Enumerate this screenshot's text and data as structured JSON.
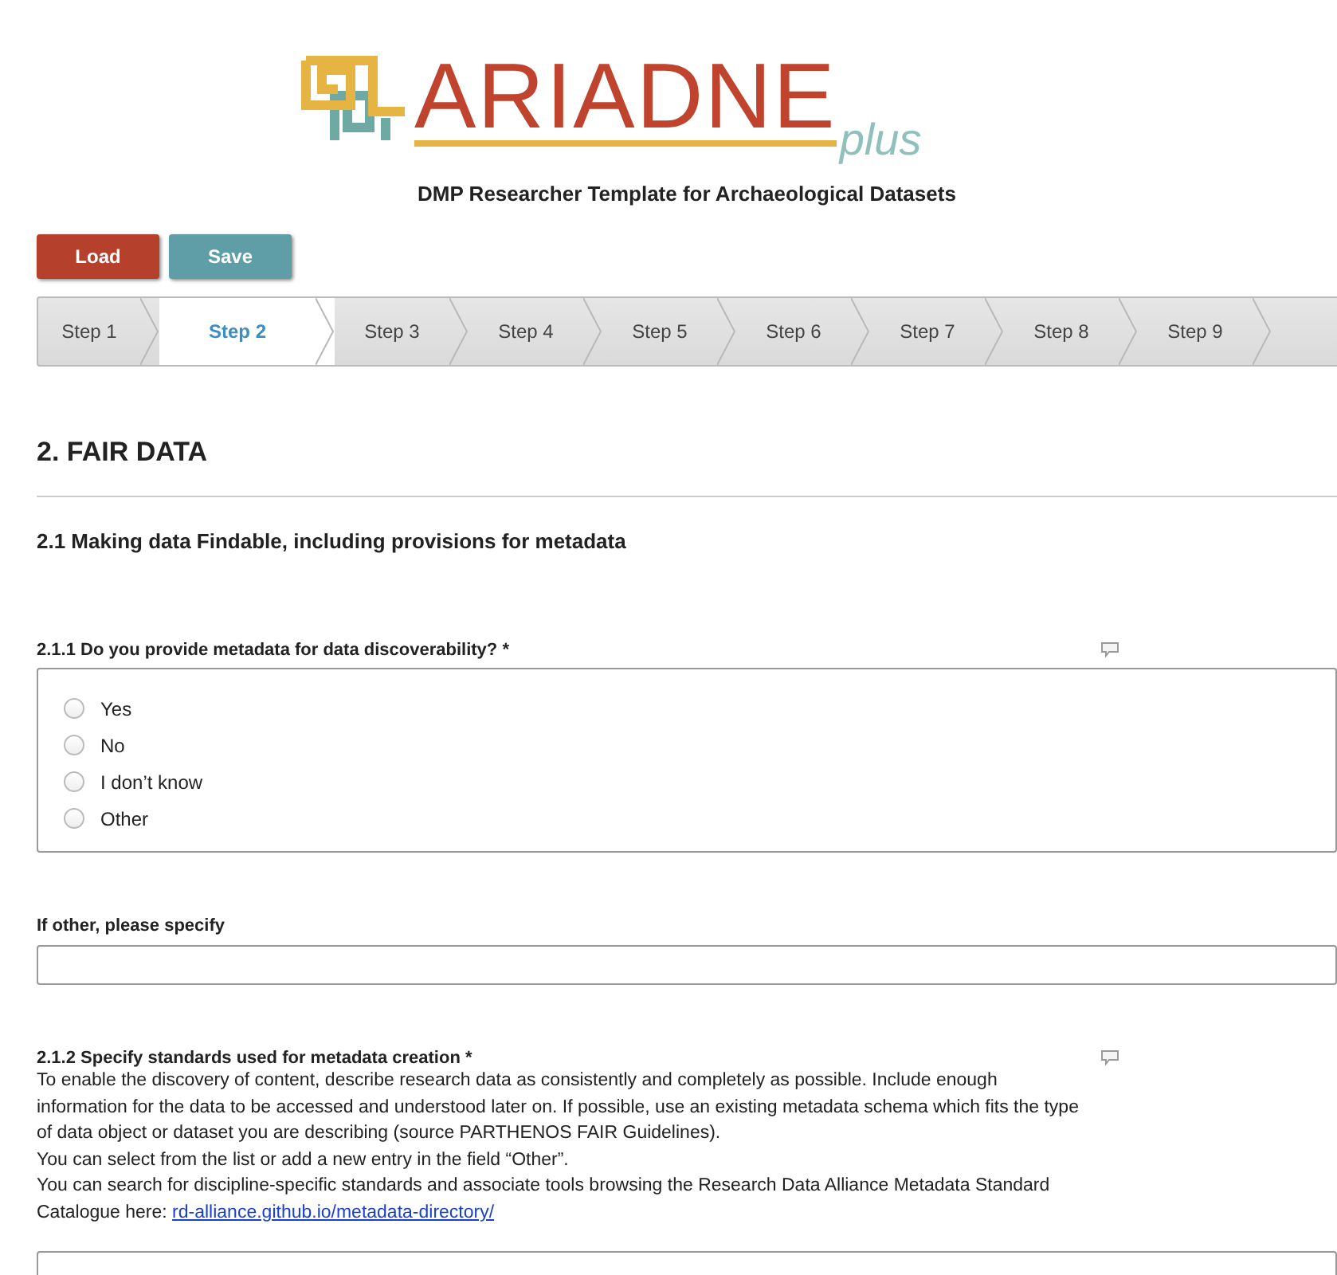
{
  "logo": {
    "name": "ARIADNE",
    "suffix": "plus"
  },
  "subtitle": "DMP Researcher Template for Archaeological Datasets",
  "buttons": [
    {
      "label": "Load",
      "kind": "load"
    },
    {
      "label": "Save",
      "kind": "save"
    }
  ],
  "steps": [
    {
      "label": "Step 1",
      "selected": false
    },
    {
      "label": "Step 2",
      "selected": true
    },
    {
      "label": "Step 3",
      "selected": false
    },
    {
      "label": "Step 4",
      "selected": false
    },
    {
      "label": "Step 5",
      "selected": false
    },
    {
      "label": "Step 6",
      "selected": false
    },
    {
      "label": "Step 7",
      "selected": false
    },
    {
      "label": "Step 8",
      "selected": false
    },
    {
      "label": "Step 9",
      "selected": false
    }
  ],
  "section_title": "2. FAIR DATA",
  "subsection_title": "2.1 Making data Findable, including provisions for metadata",
  "questions": [
    {
      "kind": "radio",
      "label": "2.1.1 Do you provide metadata for data discoverability? *",
      "options": [
        {
          "label": "Yes",
          "selected": false
        },
        {
          "label": "No",
          "selected": false
        },
        {
          "label": "I don’t know",
          "selected": false
        },
        {
          "label": "Other",
          "selected": false
        }
      ]
    },
    {
      "kind": "text",
      "label": "If other, please specify"
    },
    {
      "kind": "longtext",
      "label": "2.1.2 Specify standards used for metadata creation *",
      "paragraphs": [
        {
          "text": "To enable the discovery of content, describe research data as consistently and completely as possible. Include enough information for the data to be accessed and understood later on. If possible, use an existing metadata schema which fits the type of data object or dataset you are describing (source PARTHENOS FAIR Guidelines)."
        },
        {
          "text": "You can select from the list or add a new entry in the field “Other”."
        },
        {
          "text": "You can search for discipline-specific standards and associate tools browsing the Research Data Alliance Metadata Standard Catalogue here: ",
          "link": "rd-alliance.github.io/metadata-directory/"
        }
      ]
    }
  ]
}
